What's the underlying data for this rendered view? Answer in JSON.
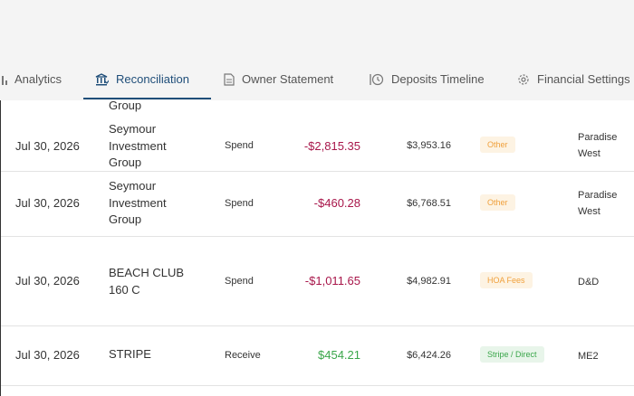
{
  "tabs": [
    {
      "label": "Analytics",
      "icon": "bar-chart-icon",
      "active": false
    },
    {
      "label": "Reconciliation",
      "icon": "bank-icon",
      "active": true
    },
    {
      "label": "Owner Statement",
      "icon": "document-icon",
      "active": false
    },
    {
      "label": "Deposits Timeline",
      "icon": "history-icon",
      "active": false
    },
    {
      "label": "Financial Settings",
      "icon": "gear-icon",
      "active": false
    }
  ],
  "colors": {
    "accent": "#1f4e79",
    "negative": "#a8164a",
    "positive": "#3aa64a",
    "badge_orange": "#f0a03c"
  },
  "rows": [
    {
      "desc_lines": [
        "Group"
      ]
    },
    {
      "date": "Jul 30, 2026",
      "desc_lines": [
        "Seymour",
        "Investment",
        "Group"
      ],
      "type": "Spend",
      "amount": "-$2,815.35",
      "balance": "$3,953.16",
      "category": "Other",
      "property_lines": [
        "Paradise",
        "West"
      ]
    },
    {
      "date": "Jul 30, 2026",
      "desc_lines": [
        "Seymour",
        "Investment",
        "Group"
      ],
      "type": "Spend",
      "amount": "-$460.28",
      "balance": "$6,768.51",
      "category": "Other",
      "property_lines": [
        "Paradise",
        "West"
      ]
    },
    {
      "date": "Jul 30, 2026",
      "desc_lines": [
        "BEACH CLUB",
        "160 C"
      ],
      "type": "Spend",
      "amount": "-$1,011.65",
      "balance": "$4,982.91",
      "category": "HOA Fees",
      "property_lines": [
        "D&D"
      ]
    },
    {
      "date": "Jul 30, 2026",
      "desc_lines": [
        "STRIPE"
      ],
      "type": "Receive",
      "amount": "$454.21",
      "balance": "$6,424.26",
      "category": "Stripe / Direct",
      "property_lines": [
        "ME2"
      ]
    }
  ]
}
